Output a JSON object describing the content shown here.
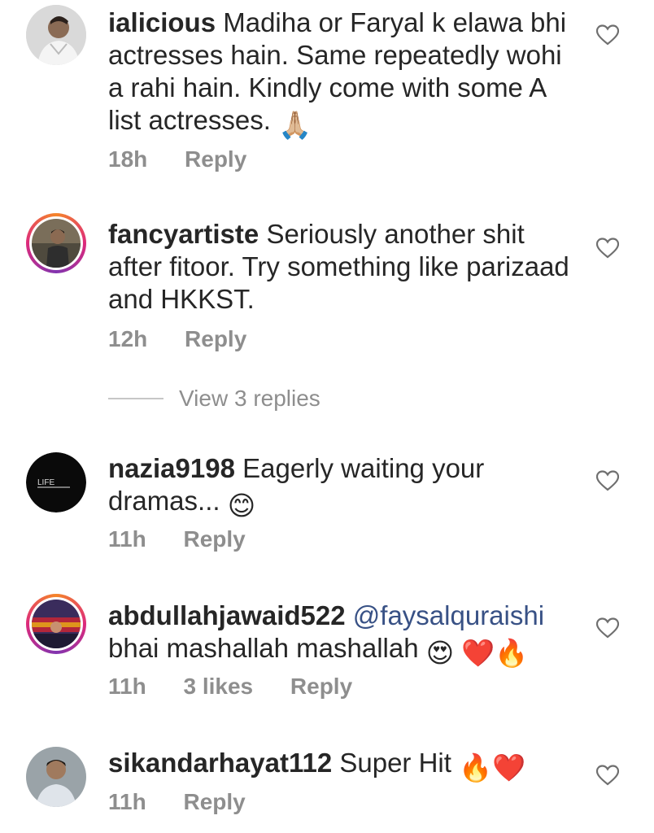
{
  "comments": [
    {
      "username": "ialicious",
      "text": "Madiha or Faryal k elawa bhi actresses hain. Same repeatedly wohi a rahi hain. Kindly come with some A list actresses.",
      "emoji": "🙏🏼",
      "time": "18h",
      "reply_label": "Reply"
    },
    {
      "username": "fancyartiste",
      "text": "Seriously another shit after fitoor. Try something like parizaad and HKKST.",
      "time": "12h",
      "reply_label": "Reply",
      "view_replies": "View 3 replies"
    },
    {
      "username": "nazia9198",
      "text": "Eagerly waiting your dramas...",
      "emoji": "😊",
      "time": "11h",
      "reply_label": "Reply",
      "avatar_text": "LIFE"
    },
    {
      "username": "abdullahjawaid522",
      "mention": "@faysalquraishi",
      "text": "bhai mashallah mashallah",
      "emoji": "😍 ❤️🔥",
      "time": "11h",
      "likes": "3 likes",
      "reply_label": "Reply"
    },
    {
      "username": "sikandarhayat112",
      "text": "Super Hit",
      "emoji": "🔥❤️",
      "time": "11h",
      "reply_label": "Reply"
    }
  ],
  "colors": {
    "text": "#262626",
    "meta": "#8e8e8e",
    "mention": "#385185",
    "story_ring": "#dd2a7b"
  },
  "icons": {
    "like": "heart-outline-icon"
  }
}
